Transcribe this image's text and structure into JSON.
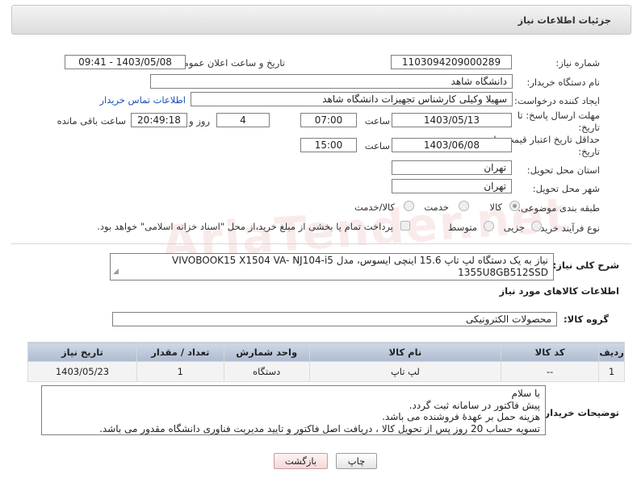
{
  "header": {
    "title": "جزئیات اطلاعات نیاز"
  },
  "watermark": "AriaTender.net",
  "fields": {
    "need_number_label": "شماره نیاز:",
    "need_number": "1103094209000289",
    "announce_label": "تاریخ و ساعت اعلان عمومی:",
    "announce_value": "1403/05/08 - 09:41",
    "buyer_org_label": "نام دستگاه خریدار:",
    "buyer_org": "دانشگاه شاهد",
    "creator_label": "ایجاد کننده درخواست:",
    "creator": "سهیلا وکیلی کارشناس تجهیزات دانشگاه شاهد",
    "buyer_contact_link": "اطلاعات تماس خریدار",
    "deadline_label_1": "مهلت ارسال پاسخ: تا",
    "deadline_label_2": "تاریخ:",
    "deadline_date": "1403/05/13",
    "time_label": "ساعت",
    "deadline_time": "07:00",
    "days_value": "4",
    "days_label": "روز و",
    "remaining_time": "20:49:18",
    "remaining_label": "ساعت باقی مانده",
    "validity_label_1": "حداقل تاریخ اعتبار قیمت: تا",
    "validity_label_2": "تاریخ:",
    "validity_date": "1403/06/08",
    "validity_time": "15:00",
    "province_label": "استان محل تحویل:",
    "province": "تهران",
    "city_label": "شهر محل تحویل:",
    "city": "تهران",
    "category_label": "طبقه بندی موضوعی:",
    "category_options": [
      "کالا",
      "خدمت",
      "کالا/خدمت"
    ],
    "purchase_type_label": "نوع فرآیند خرید :",
    "purchase_options": [
      "جزیی",
      "متوسط"
    ],
    "payment_note": "پرداخت تمام یا بخشی از مبلغ خرید،از محل \"اسناد خزانه اسلامی\" خواهد بود.",
    "description_label": "شرح کلی نیاز:",
    "description_line1": "نیاز به یک دستگاه لپ تاپ 15.6 اینچی ایسوس، مدل VIVOBOOK15 X1504 VA- NJ104-i5",
    "description_line2": "1355U8GB512SSD"
  },
  "goods_section": {
    "title": "اطلاعات کالاهای مورد نیاز",
    "group_label": "گروه کالا:",
    "group_value": "محصولات الکترونیکی"
  },
  "table": {
    "headers": [
      "ردیف",
      "کد کالا",
      "نام کالا",
      "واحد شمارش",
      "تعداد / مقدار",
      "تاریخ نیاز"
    ],
    "rows": [
      [
        "1",
        "--",
        "لپ تاپ",
        "دستگاه",
        "1",
        "1403/05/23"
      ]
    ]
  },
  "buyer_notes": {
    "label": "توضیحات خریدار:",
    "lines": [
      "با سلام",
      "پیش فاکتور در سامانه ثبت گردد.",
      "هزینه حمل بر عهدهٔ فروشنده می باشد.",
      "تسویه حساب 20 روز پس از تحویل کالا ، دریافت اصل فاکتور و تایید مدیریت فناوری دانشگاه مقدور می باشد."
    ]
  },
  "buttons": {
    "print": "چاپ",
    "back": "بازگشت"
  }
}
